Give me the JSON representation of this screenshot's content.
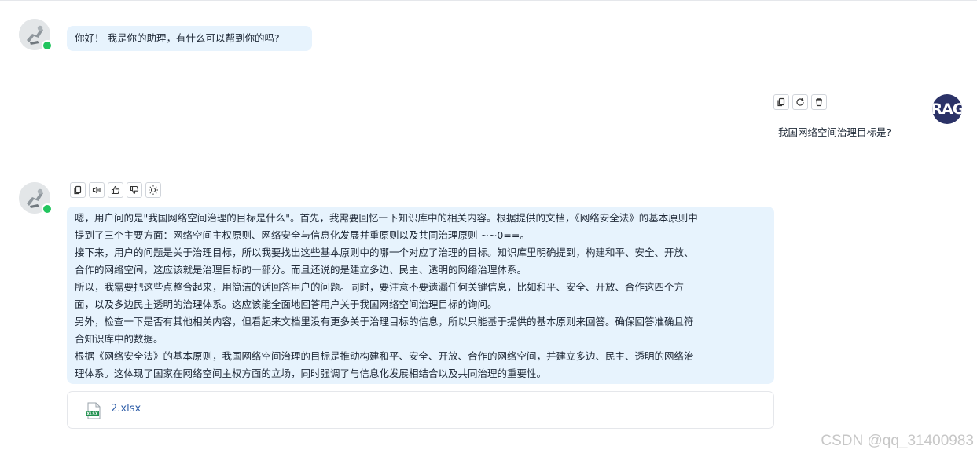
{
  "greeting": {
    "text": "你好！ 我是你的助理，有什么可以帮到你的吗?"
  },
  "user_message": {
    "avatar_text": "RAG",
    "text": "我国网络空间治理目标是?",
    "actions": [
      "copy-icon",
      "refresh-icon",
      "delete-icon"
    ]
  },
  "assistant_message": {
    "actions": [
      "copy-icon",
      "speaker-icon",
      "thumbs-up-icon",
      "thumbs-down-icon",
      "lightbulb-icon"
    ],
    "lines": [
      "嗯，用户问的是\"我国网络空间治理的目标是什么\"。首先，我需要回忆一下知识库中的相关内容。根据提供的文档，《网络安全法》的基本原则中",
      "提到了三个主要方面：网络空间主权原则、网络安全与信息化发展并重原则以及共同治理原则 ~~0==。",
      "接下来，用户的问题是关于治理目标，所以我要找出这些基本原则中的哪一个对应了治理的目标。知识库里明确提到，构建和平、安全、开放、",
      "合作的网络空间，这应该就是治理目标的一部分。而且还说的是建立多边、民主、透明的网络治理体系。",
      "所以，我需要把这些点整合起来，用简洁的话回答用户的问题。同时，要注意不要遗漏任何关键信息，比如和平、安全、开放、合作这四个方",
      "面，以及多边民主透明的治理体系。这应该能全面地回答用户关于我国网络空间治理目标的询问。",
      "另外，检查一下是否有其他相关内容，但看起来文档里没有更多关于治理目标的信息，所以只能基于提供的基本原则来回答。确保回答准确且符",
      "合知识库中的数据。",
      "根据《网络安全法》的基本原则，我国网络空间治理的目标是推动构建和平、安全、开放、合作的网络空间，并建立多边、民主、透明的网络治",
      "理体系。这体现了国家在网络空间主权方面的立场，同时强调了与信息化发展相结合以及共同治理的重要性。"
    ],
    "attachment": {
      "icon": "xlsx-file-icon",
      "icon_label": "XLSX",
      "name": "2.xlsx"
    }
  },
  "watermark": "CSDN @qq_31400983",
  "colors": {
    "bubble": "#e7f3fd",
    "online": "#22c55e",
    "rag_avatar": "#2b3267",
    "file_green": "#1f8f4e",
    "link": "#2f5ea8"
  }
}
